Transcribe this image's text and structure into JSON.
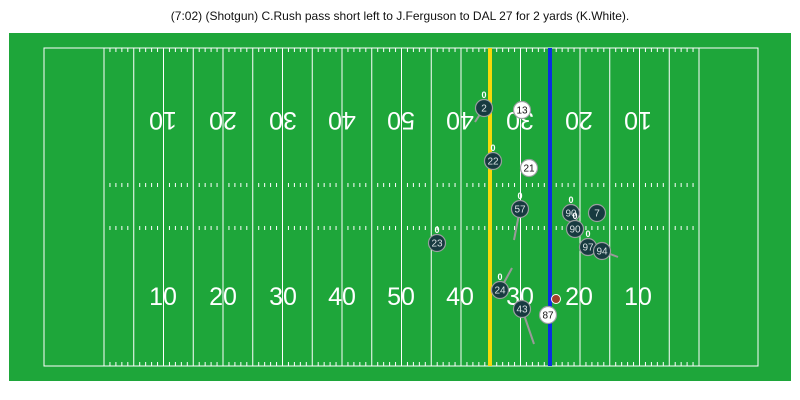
{
  "play": {
    "description": "(7:02) (Shotgun) C.Rush pass short left to J.Ferguson to DAL 27 for 2 yards (K.White)."
  },
  "colors": {
    "field": "#1ea63a",
    "lines": "#ffffff",
    "first_down_line": "#f5d90a",
    "line_of_scrimmage": "#0a2ee0",
    "defense": "#173a40",
    "offense": "#ffffff",
    "ball": "#a0412c",
    "track": "#9a9a9a"
  },
  "field": {
    "bottom_numbers": [
      "10",
      "20",
      "30",
      "40",
      "50",
      "40",
      "30",
      "20",
      "10"
    ],
    "top_numbers": [
      "10",
      "20",
      "30",
      "40",
      "50",
      "40",
      "30",
      "20",
      "10"
    ]
  },
  "players": [
    {
      "label": "2",
      "team": "defense",
      "speed": "0"
    },
    {
      "label": "13",
      "team": "offense",
      "speed": ""
    },
    {
      "label": "22",
      "team": "defense",
      "speed": "0"
    },
    {
      "label": "21",
      "team": "offense",
      "speed": ""
    },
    {
      "label": "57",
      "team": "defense",
      "speed": "0"
    },
    {
      "label": "90",
      "team": "defense",
      "speed": "0"
    },
    {
      "label": "7",
      "team": "defense",
      "speed": ""
    },
    {
      "label": "90",
      "team": "defense",
      "speed": "0"
    },
    {
      "label": "97",
      "team": "defense",
      "speed": "0"
    },
    {
      "label": "94",
      "team": "defense",
      "speed": ""
    },
    {
      "label": "23",
      "team": "defense",
      "speed": "0"
    },
    {
      "label": "24",
      "team": "defense",
      "speed": "0"
    },
    {
      "label": "43",
      "team": "defense",
      "speed": ""
    },
    {
      "label": "87",
      "team": "offense",
      "speed": ""
    }
  ]
}
